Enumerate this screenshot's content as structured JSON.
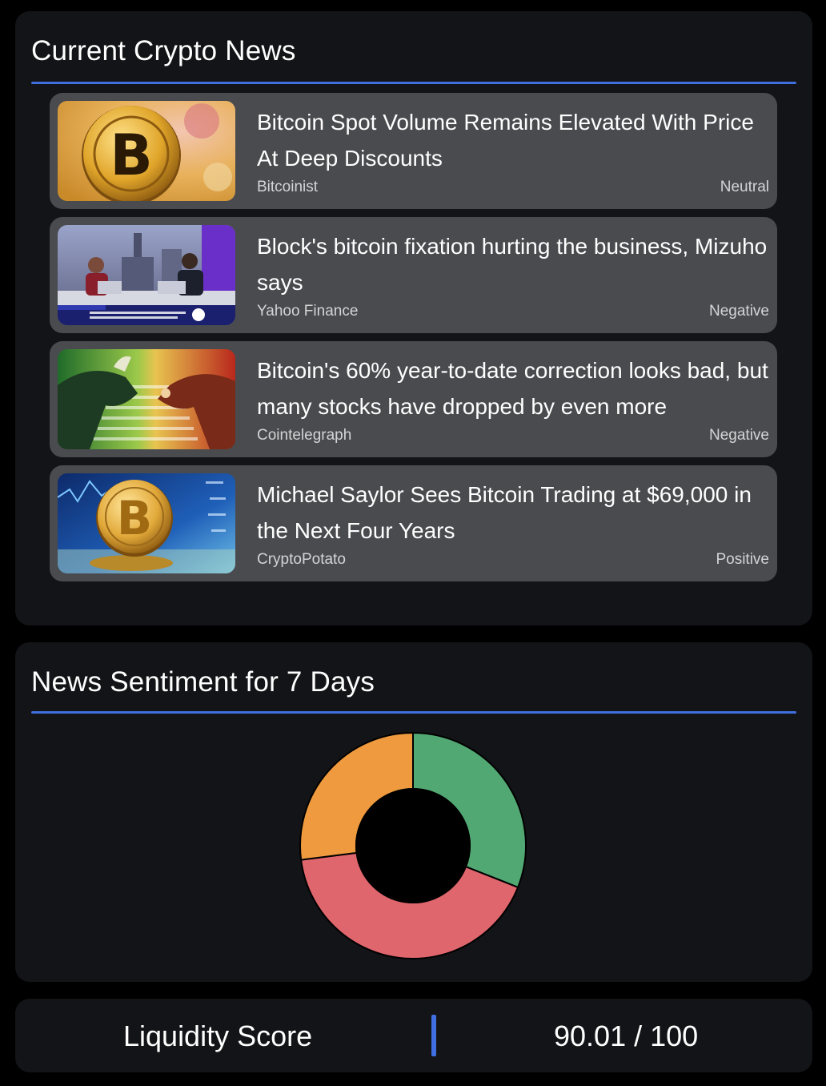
{
  "news": {
    "title": "Current Crypto News",
    "items": [
      {
        "title": "Bitcoin Spot Volume Remains Elevated With Price At Deep Discounts",
        "source": "Bitcoinist",
        "sentiment": "Neutral"
      },
      {
        "title": "Block's bitcoin fixation hurting the business, Mizuho says",
        "source": "Yahoo Finance",
        "sentiment": "Negative"
      },
      {
        "title": "Bitcoin's 60% year-to-date correction looks bad, but many stocks have dropped by even more",
        "source": "Cointelegraph",
        "sentiment": "Negative"
      },
      {
        "title": "Michael Saylor Sees Bitcoin Trading at $69,000 in the Next Four Years",
        "source": "CryptoPotato",
        "sentiment": "Positive"
      }
    ]
  },
  "sentiment": {
    "title": "News Sentiment for 7 Days"
  },
  "chart_data": {
    "type": "pie",
    "hole": true,
    "values": [
      31,
      42,
      27
    ],
    "colors": [
      "#52a873",
      "#e0666e",
      "#ef9a3e"
    ]
  },
  "liquidity": {
    "label": "Liquidity Score",
    "value": "90.01 / 100"
  },
  "colors": {
    "accent": "#3f6fe0",
    "card": "#131417",
    "news_item": "#4a4b4f"
  }
}
